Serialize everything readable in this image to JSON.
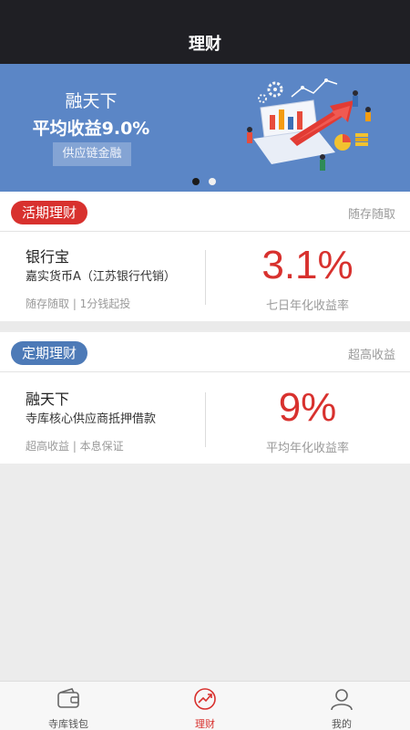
{
  "header": {
    "title": "理财"
  },
  "banner": {
    "title": "融天下",
    "subtitle": "平均收益9.0%",
    "tag": "供应链金融",
    "page_count": 2,
    "active_page": 1
  },
  "sections": [
    {
      "badge": "活期理财",
      "right_text": "随存随取",
      "product": {
        "name": "银行宝",
        "desc": "嘉实货币A（江苏银行代销）",
        "footer": "随存随取 | 1分钱起投",
        "rate": "3.1%",
        "rate_label": "七日年化收益率"
      }
    },
    {
      "badge": "定期理财",
      "right_text": "超高收益",
      "product": {
        "name": "融天下",
        "desc": "寺库核心供应商抵押借款",
        "footer": "超高收益 | 本息保证",
        "rate": "9%",
        "rate_label": "平均年化收益率"
      }
    }
  ],
  "tabbar": {
    "tabs": [
      {
        "label": "寺库钱包",
        "icon": "wallet-icon",
        "active": false
      },
      {
        "label": "理财",
        "icon": "trend-chart-icon",
        "active": true
      },
      {
        "label": "我的",
        "icon": "user-icon",
        "active": false
      }
    ]
  },
  "colors": {
    "header_bg": "#1f1f24",
    "banner_bg": "#5b86c6",
    "accent_red": "#d8312e",
    "accent_blue": "#4d7ab7"
  }
}
